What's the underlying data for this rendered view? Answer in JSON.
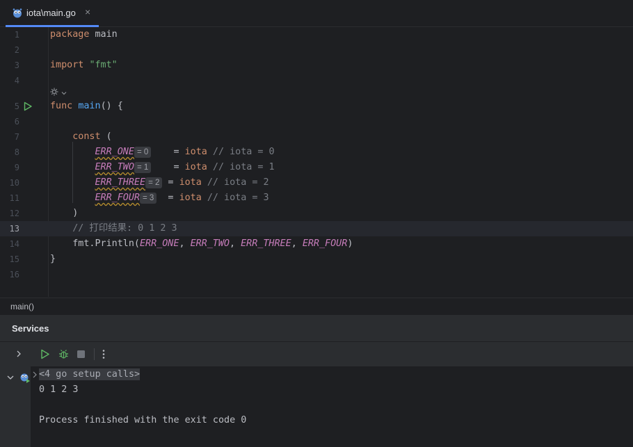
{
  "tab": {
    "label": "iota\\main.go",
    "close": "×"
  },
  "code_lines": [
    {
      "n": "1",
      "tokens": [
        {
          "c": "kw",
          "t": "package"
        },
        {
          "c": "",
          "t": " main"
        }
      ]
    },
    {
      "n": "2",
      "tokens": []
    },
    {
      "n": "3",
      "tokens": [
        {
          "c": "kw",
          "t": "import"
        },
        {
          "c": "",
          "t": " "
        },
        {
          "c": "str",
          "t": "\"fmt\""
        }
      ]
    },
    {
      "n": "4",
      "tokens": []
    },
    {
      "n": "5",
      "tokens": [
        {
          "c": "kw",
          "t": "func"
        },
        {
          "c": "",
          "t": " "
        },
        {
          "c": "fn",
          "t": "main"
        },
        {
          "c": "",
          "t": "() {"
        }
      ]
    },
    {
      "n": "6",
      "tokens": []
    },
    {
      "n": "7",
      "tokens": [
        {
          "c": "",
          "t": "    "
        },
        {
          "c": "kw",
          "t": "const"
        },
        {
          "c": "",
          "t": " ("
        }
      ]
    },
    {
      "n": "8",
      "tokens": [
        {
          "c": "",
          "t": "        "
        },
        {
          "c": "const wavy",
          "t": "ERR_ONE"
        },
        {
          "c": "hint",
          "t": "= 0"
        },
        {
          "c": "",
          "t": "    = "
        },
        {
          "c": "io",
          "t": "iota"
        },
        {
          "c": "cm",
          "t": " // iota = 0"
        }
      ]
    },
    {
      "n": "9",
      "tokens": [
        {
          "c": "",
          "t": "        "
        },
        {
          "c": "const wavy",
          "t": "ERR_TWO"
        },
        {
          "c": "hint",
          "t": "= 1"
        },
        {
          "c": "",
          "t": "    = "
        },
        {
          "c": "io",
          "t": "iota"
        },
        {
          "c": "cm",
          "t": " // iota = 1"
        }
      ]
    },
    {
      "n": "10",
      "tokens": [
        {
          "c": "",
          "t": "        "
        },
        {
          "c": "const wavy",
          "t": "ERR_THREE"
        },
        {
          "c": "hint",
          "t": "= 2"
        },
        {
          "c": "",
          "t": " = "
        },
        {
          "c": "io",
          "t": "iota"
        },
        {
          "c": "cm",
          "t": " // iota = 2"
        }
      ]
    },
    {
      "n": "11",
      "tokens": [
        {
          "c": "",
          "t": "        "
        },
        {
          "c": "const wavy",
          "t": "ERR_FOUR"
        },
        {
          "c": "hint",
          "t": "= 3"
        },
        {
          "c": "",
          "t": "  = "
        },
        {
          "c": "io",
          "t": "iota"
        },
        {
          "c": "cm",
          "t": " // iota = 3"
        }
      ]
    },
    {
      "n": "12",
      "tokens": [
        {
          "c": "",
          "t": "    )"
        }
      ]
    },
    {
      "n": "13",
      "current": true,
      "tokens": [
        {
          "c": "",
          "t": "    "
        },
        {
          "c": "cm",
          "t": "// 打印结果: 0 1 2 3"
        }
      ]
    },
    {
      "n": "14",
      "tokens": [
        {
          "c": "",
          "t": "    fmt."
        },
        {
          "c": "",
          "t": "Println("
        },
        {
          "c": "const",
          "t": "ERR_ONE"
        },
        {
          "c": "",
          "t": ", "
        },
        {
          "c": "const",
          "t": "ERR_TWO"
        },
        {
          "c": "",
          "t": ", "
        },
        {
          "c": "const",
          "t": "ERR_THREE"
        },
        {
          "c": "",
          "t": ", "
        },
        {
          "c": "const",
          "t": "ERR_FOUR"
        },
        {
          "c": "",
          "t": ")"
        }
      ]
    },
    {
      "n": "15",
      "tokens": [
        {
          "c": "",
          "t": "}"
        }
      ]
    },
    {
      "n": "16",
      "tokens": []
    }
  ],
  "breadcrumb": "main()",
  "services": {
    "title": "Services",
    "toolbar_icons": [
      "run-icon",
      "debug-icon",
      "stop-icon",
      "more-icon"
    ],
    "console": {
      "setup_calls": "<4 go setup calls>",
      "output": "0 1 2 3",
      "exit_message": "Process finished with the exit code 0"
    }
  },
  "colors": {
    "keyword": "#cf8e6d",
    "function": "#56a8f5",
    "string": "#6aab73",
    "comment": "#7a7e85",
    "constant": "#c77dbb",
    "accent": "#548af7",
    "run_green": "#5fb865"
  }
}
